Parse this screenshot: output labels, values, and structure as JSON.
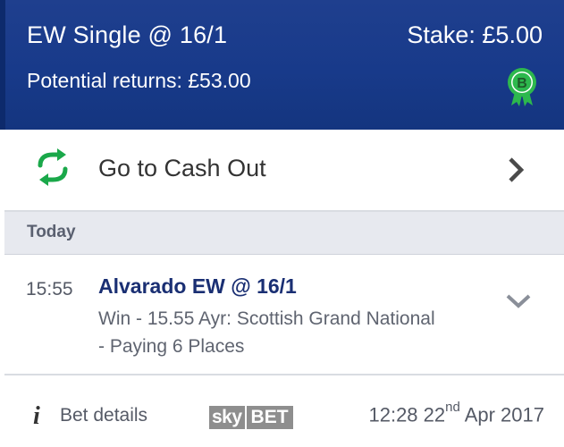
{
  "header": {
    "bet_type": "EW Single @ 16/1",
    "stake": "Stake: £5.00",
    "potential_returns": "Potential returns: £53.00",
    "badge_letter": "B",
    "badge_color": "#2db84d"
  },
  "cashout": {
    "label": "Go to Cash Out",
    "icon": "cash-out-arrows-icon",
    "icon_color": "#1aa84a"
  },
  "date_group": {
    "label": "Today"
  },
  "bet": {
    "time": "15:55",
    "selection": "Alvarado EW @ 16/1",
    "market_line1": "Win - 15.55 Ayr: Scottish Grand National",
    "market_line2": "- Paying 6 Places"
  },
  "footer": {
    "details_label": "Bet details",
    "brand_sky": "sky",
    "brand_bet": "BET",
    "time": "12:28 22",
    "day_suffix": "nd",
    "month_year": " Apr 2017"
  },
  "colors": {
    "header_bg": "#183a8a",
    "selection_text": "#1a2f73",
    "date_header_bg": "#e7e9ef"
  }
}
